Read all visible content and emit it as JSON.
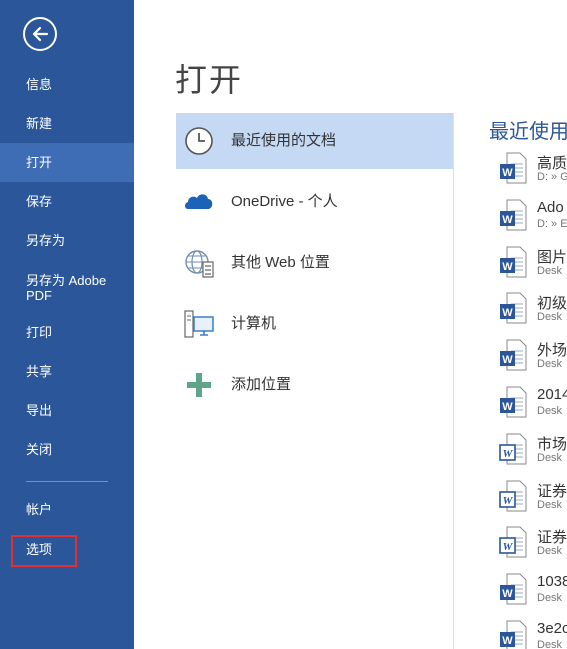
{
  "nav": {
    "items": [
      {
        "label": "信息"
      },
      {
        "label": "新建"
      },
      {
        "label": "打开"
      },
      {
        "label": "保存"
      },
      {
        "label": "另存为"
      },
      {
        "label": "另存为 Adobe PDF"
      },
      {
        "label": "打印"
      },
      {
        "label": "共享"
      },
      {
        "label": "导出"
      },
      {
        "label": "关闭"
      },
      {
        "label": "帐户"
      },
      {
        "label": "选项"
      }
    ],
    "active_item": "打开"
  },
  "main": {
    "title": "打开",
    "places": [
      {
        "label": "最近使用的文档",
        "icon": "clock-icon"
      },
      {
        "label": "OneDrive - 个人",
        "icon": "cloud-icon"
      },
      {
        "label": "其他 Web 位置",
        "icon": "globe-server-icon"
      },
      {
        "label": "计算机",
        "icon": "computer-icon"
      },
      {
        "label": "添加位置",
        "icon": "plus-icon"
      }
    ]
  },
  "recent": {
    "title": "最近使用",
    "items": [
      {
        "name": "高质",
        "path": "D: » G"
      },
      {
        "name": "Ado",
        "path": "D: » E"
      },
      {
        "name": "图片",
        "path": "Desk"
      },
      {
        "name": "初级",
        "path": "Desk"
      },
      {
        "name": "外场",
        "path": "Desk"
      },
      {
        "name": "2014",
        "path": "Desk"
      },
      {
        "name": "市场",
        "path": "Desk"
      },
      {
        "name": "证券",
        "path": "Desk"
      },
      {
        "name": "证券",
        "path": "Desk"
      },
      {
        "name": "1038",
        "path": "Desk"
      },
      {
        "name": "3e2c",
        "path": "Desk"
      }
    ]
  },
  "colors": {
    "nav_bg": "#2b579a",
    "nav_active": "#3e6db5",
    "place_active": "#c5d9f4",
    "highlight_box": "#e0312f"
  }
}
